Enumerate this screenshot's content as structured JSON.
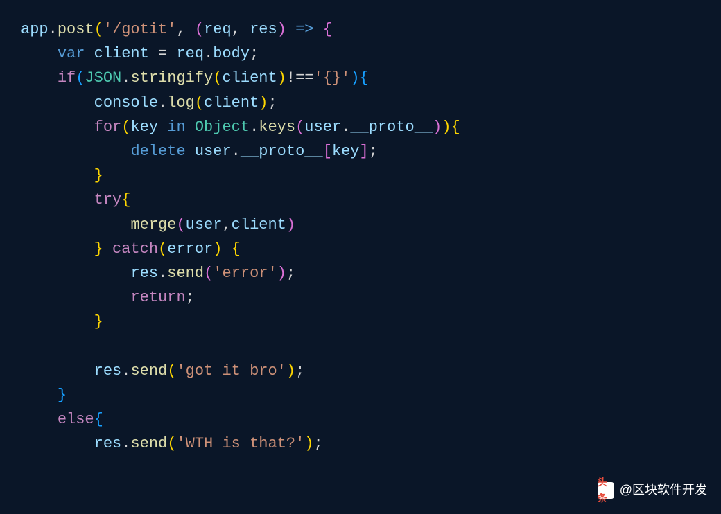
{
  "code": {
    "lines": [
      {
        "indent": 0,
        "tokens": [
          {
            "t": "app",
            "c": "obj"
          },
          {
            "t": ".",
            "c": "punct"
          },
          {
            "t": "post",
            "c": "method"
          },
          {
            "t": "(",
            "c": "paren-yellow"
          },
          {
            "t": "'/gotit'",
            "c": "string"
          },
          {
            "t": ", ",
            "c": "punct"
          },
          {
            "t": "(",
            "c": "paren-purple"
          },
          {
            "t": "req",
            "c": "var"
          },
          {
            "t": ", ",
            "c": "punct"
          },
          {
            "t": "res",
            "c": "var"
          },
          {
            "t": ")",
            "c": "paren-purple"
          },
          {
            "t": " ",
            "c": "punct"
          },
          {
            "t": "=>",
            "c": "keyword-blue"
          },
          {
            "t": " ",
            "c": "punct"
          },
          {
            "t": "{",
            "c": "paren-purple"
          }
        ]
      },
      {
        "indent": 1,
        "tokens": [
          {
            "t": "var",
            "c": "keyword-blue"
          },
          {
            "t": " ",
            "c": "punct"
          },
          {
            "t": "client",
            "c": "var"
          },
          {
            "t": " = ",
            "c": "punct"
          },
          {
            "t": "req",
            "c": "var"
          },
          {
            "t": ".",
            "c": "punct"
          },
          {
            "t": "body",
            "c": "prop"
          },
          {
            "t": ";",
            "c": "punct"
          }
        ]
      },
      {
        "indent": 1,
        "tokens": [
          {
            "t": "if",
            "c": "keyword-purple"
          },
          {
            "t": "(",
            "c": "paren-blue"
          },
          {
            "t": "JSON",
            "c": "class"
          },
          {
            "t": ".",
            "c": "punct"
          },
          {
            "t": "stringify",
            "c": "method"
          },
          {
            "t": "(",
            "c": "paren-yellow"
          },
          {
            "t": "client",
            "c": "var"
          },
          {
            "t": ")",
            "c": "paren-yellow"
          },
          {
            "t": "!==",
            "c": "punct"
          },
          {
            "t": "'{}'",
            "c": "string"
          },
          {
            "t": ")",
            "c": "paren-blue"
          },
          {
            "t": "{",
            "c": "paren-blue"
          }
        ]
      },
      {
        "indent": 2,
        "tokens": [
          {
            "t": "console",
            "c": "obj"
          },
          {
            "t": ".",
            "c": "punct"
          },
          {
            "t": "log",
            "c": "method"
          },
          {
            "t": "(",
            "c": "paren-yellow"
          },
          {
            "t": "client",
            "c": "var"
          },
          {
            "t": ")",
            "c": "paren-yellow"
          },
          {
            "t": ";",
            "c": "punct"
          }
        ]
      },
      {
        "indent": 2,
        "tokens": [
          {
            "t": "for",
            "c": "keyword-purple"
          },
          {
            "t": "(",
            "c": "paren-yellow"
          },
          {
            "t": "key",
            "c": "var"
          },
          {
            "t": " ",
            "c": "punct"
          },
          {
            "t": "in",
            "c": "keyword-blue"
          },
          {
            "t": " ",
            "c": "punct"
          },
          {
            "t": "Object",
            "c": "class"
          },
          {
            "t": ".",
            "c": "punct"
          },
          {
            "t": "keys",
            "c": "method"
          },
          {
            "t": "(",
            "c": "paren-purple"
          },
          {
            "t": "user",
            "c": "var"
          },
          {
            "t": ".",
            "c": "punct"
          },
          {
            "t": "__proto__",
            "c": "prop"
          },
          {
            "t": ")",
            "c": "paren-purple"
          },
          {
            "t": ")",
            "c": "paren-yellow"
          },
          {
            "t": "{",
            "c": "paren-yellow"
          }
        ]
      },
      {
        "indent": 3,
        "tokens": [
          {
            "t": "delete",
            "c": "keyword-blue"
          },
          {
            "t": " ",
            "c": "punct"
          },
          {
            "t": "user",
            "c": "var"
          },
          {
            "t": ".",
            "c": "punct"
          },
          {
            "t": "__proto__",
            "c": "prop"
          },
          {
            "t": "[",
            "c": "paren-purple"
          },
          {
            "t": "key",
            "c": "var"
          },
          {
            "t": "]",
            "c": "paren-purple"
          },
          {
            "t": ";",
            "c": "punct"
          }
        ]
      },
      {
        "indent": 2,
        "tokens": [
          {
            "t": "}",
            "c": "paren-yellow"
          }
        ]
      },
      {
        "indent": 2,
        "tokens": [
          {
            "t": "try",
            "c": "keyword-purple"
          },
          {
            "t": "{",
            "c": "paren-yellow"
          }
        ]
      },
      {
        "indent": 3,
        "tokens": [
          {
            "t": "merge",
            "c": "method"
          },
          {
            "t": "(",
            "c": "paren-purple"
          },
          {
            "t": "user",
            "c": "var"
          },
          {
            "t": ",",
            "c": "punct"
          },
          {
            "t": "client",
            "c": "var"
          },
          {
            "t": ")",
            "c": "paren-purple"
          }
        ]
      },
      {
        "indent": 2,
        "tokens": [
          {
            "t": "}",
            "c": "paren-yellow"
          },
          {
            "t": " ",
            "c": "punct"
          },
          {
            "t": "catch",
            "c": "keyword-purple"
          },
          {
            "t": "(",
            "c": "paren-yellow"
          },
          {
            "t": "error",
            "c": "var"
          },
          {
            "t": ")",
            "c": "paren-yellow"
          },
          {
            "t": " ",
            "c": "punct"
          },
          {
            "t": "{",
            "c": "paren-yellow"
          }
        ]
      },
      {
        "indent": 3,
        "tokens": [
          {
            "t": "res",
            "c": "var"
          },
          {
            "t": ".",
            "c": "punct"
          },
          {
            "t": "send",
            "c": "method"
          },
          {
            "t": "(",
            "c": "paren-purple"
          },
          {
            "t": "'error'",
            "c": "string"
          },
          {
            "t": ")",
            "c": "paren-purple"
          },
          {
            "t": ";",
            "c": "punct"
          }
        ]
      },
      {
        "indent": 3,
        "tokens": [
          {
            "t": "return",
            "c": "keyword-purple"
          },
          {
            "t": ";",
            "c": "punct"
          }
        ]
      },
      {
        "indent": 2,
        "tokens": [
          {
            "t": "}",
            "c": "paren-yellow"
          }
        ]
      },
      {
        "indent": 2,
        "tokens": []
      },
      {
        "indent": 2,
        "tokens": [
          {
            "t": "res",
            "c": "var"
          },
          {
            "t": ".",
            "c": "punct"
          },
          {
            "t": "send",
            "c": "method"
          },
          {
            "t": "(",
            "c": "paren-yellow"
          },
          {
            "t": "'got it bro'",
            "c": "string"
          },
          {
            "t": ")",
            "c": "paren-yellow"
          },
          {
            "t": ";",
            "c": "punct"
          }
        ]
      },
      {
        "indent": 1,
        "tokens": [
          {
            "t": "}",
            "c": "paren-blue"
          }
        ]
      },
      {
        "indent": 1,
        "tokens": [
          {
            "t": "else",
            "c": "keyword-purple"
          },
          {
            "t": "{",
            "c": "paren-blue"
          }
        ]
      },
      {
        "indent": 2,
        "tokens": [
          {
            "t": "res",
            "c": "var"
          },
          {
            "t": ".",
            "c": "punct"
          },
          {
            "t": "send",
            "c": "method"
          },
          {
            "t": "(",
            "c": "paren-yellow"
          },
          {
            "t": "'WTH is that?'",
            "c": "string"
          },
          {
            "t": ")",
            "c": "paren-yellow"
          },
          {
            "t": ";",
            "c": "punct"
          }
        ]
      }
    ]
  },
  "watermark": {
    "label": "头条",
    "username": "@区块软件开发"
  }
}
